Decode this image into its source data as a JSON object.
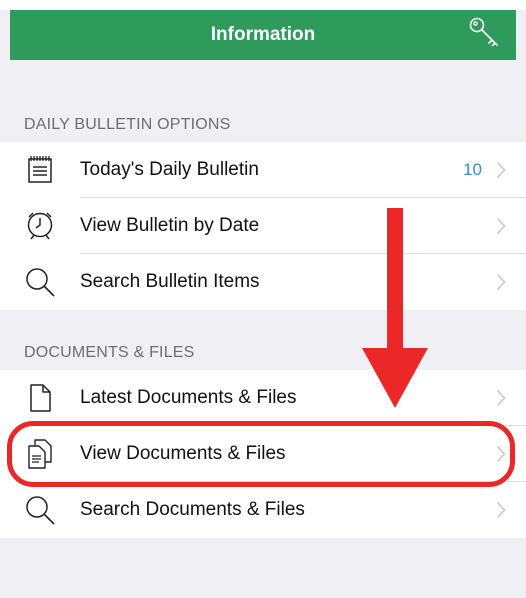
{
  "navbar": {
    "title": "Information",
    "right_icon": "key-icon",
    "color": "#2e9a5c"
  },
  "sections": [
    {
      "header": "DAILY BULLETIN OPTIONS",
      "items": [
        {
          "label": "Today's Daily Bulletin",
          "icon": "bulletin-icon",
          "count": "10"
        },
        {
          "label": "View Bulletin by Date",
          "icon": "clock-icon"
        },
        {
          "label": "Search Bulletin Items",
          "icon": "search-icon"
        }
      ]
    },
    {
      "header": "DOCUMENTS & FILES",
      "items": [
        {
          "label": "Latest Documents & Files",
          "icon": "document-icon"
        },
        {
          "label": "View Documents & Files",
          "icon": "documents-icon"
        },
        {
          "label": "Search Documents & Files",
          "icon": "search-icon"
        }
      ]
    }
  ],
  "annotation": {
    "color": "#ec2727"
  }
}
